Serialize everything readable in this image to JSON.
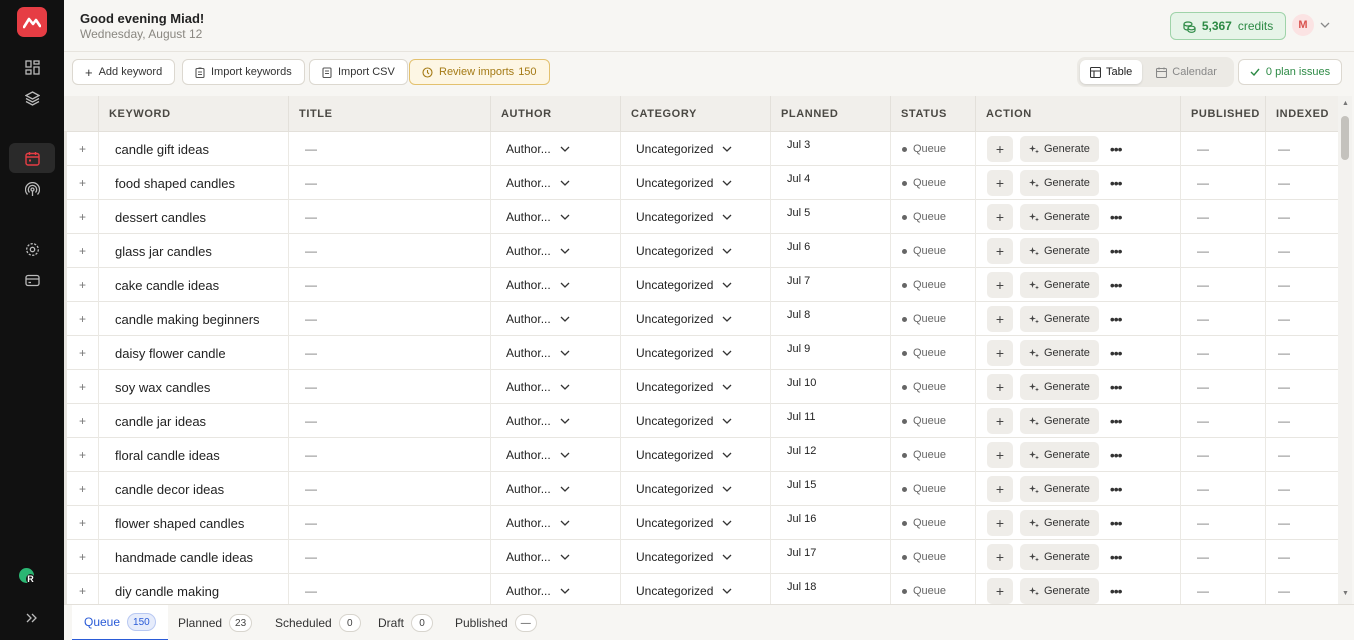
{
  "header": {
    "greeting": "Good evening Miad!",
    "date": "Wednesday, August 12",
    "credits": "5,367",
    "credits_label": "credits",
    "avatar_initial": "M"
  },
  "sidebar": {
    "status_initial": "R",
    "active_item": "calendar",
    "accent_color": "#e63d44"
  },
  "toolbar": {
    "add_keyword": "Add keyword",
    "import_keywords": "Import keywords",
    "import_csv": "Import CSV",
    "review_imports": "Review imports",
    "review_count": "150",
    "view_table": "Table",
    "view_calendar": "Calendar",
    "plan_issues": "0 plan issues"
  },
  "table": {
    "columns": [
      "KEYWORD",
      "TITLE",
      "AUTHOR",
      "CATEGORY",
      "PLANNED",
      "STATUS",
      "ACTION",
      "PUBLISHED",
      "INDEXED"
    ],
    "rows": [
      {
        "keyword": "candle gift ideas",
        "title": "—",
        "author": "Author...",
        "category": "Uncategorized",
        "planned": "Jul 3",
        "status": "Queue",
        "published": "—",
        "indexed": "—"
      },
      {
        "keyword": "food shaped candles",
        "title": "—",
        "author": "Author...",
        "category": "Uncategorized",
        "planned": "Jul 4",
        "status": "Queue",
        "published": "—",
        "indexed": "—"
      },
      {
        "keyword": "dessert candles",
        "title": "—",
        "author": "Author...",
        "category": "Uncategorized",
        "planned": "Jul 5",
        "status": "Queue",
        "published": "—",
        "indexed": "—"
      },
      {
        "keyword": "glass jar candles",
        "title": "—",
        "author": "Author...",
        "category": "Uncategorized",
        "planned": "Jul 6",
        "status": "Queue",
        "published": "—",
        "indexed": "—"
      },
      {
        "keyword": "cake candle ideas",
        "title": "—",
        "author": "Author...",
        "category": "Uncategorized",
        "planned": "Jul 7",
        "status": "Queue",
        "published": "—",
        "indexed": "—"
      },
      {
        "keyword": "candle making beginners",
        "title": "—",
        "author": "Author...",
        "category": "Uncategorized",
        "planned": "Jul 8",
        "status": "Queue",
        "published": "—",
        "indexed": "—"
      },
      {
        "keyword": "daisy flower candle",
        "title": "—",
        "author": "Author...",
        "category": "Uncategorized",
        "planned": "Jul 9",
        "status": "Queue",
        "published": "—",
        "indexed": "—"
      },
      {
        "keyword": "soy wax candles",
        "title": "—",
        "author": "Author...",
        "category": "Uncategorized",
        "planned": "Jul 10",
        "status": "Queue",
        "published": "—",
        "indexed": "—"
      },
      {
        "keyword": "candle jar ideas",
        "title": "—",
        "author": "Author...",
        "category": "Uncategorized",
        "planned": "Jul 11",
        "status": "Queue",
        "published": "—",
        "indexed": "—"
      },
      {
        "keyword": "floral candle ideas",
        "title": "—",
        "author": "Author...",
        "category": "Uncategorized",
        "planned": "Jul 12",
        "status": "Queue",
        "published": "—",
        "indexed": "—"
      },
      {
        "keyword": "candle decor ideas",
        "title": "—",
        "author": "Author...",
        "category": "Uncategorized",
        "planned": "Jul 15",
        "status": "Queue",
        "published": "—",
        "indexed": "—"
      },
      {
        "keyword": "flower shaped candles",
        "title": "—",
        "author": "Author...",
        "category": "Uncategorized",
        "planned": "Jul 16",
        "status": "Queue",
        "published": "—",
        "indexed": "—"
      },
      {
        "keyword": "handmade candle ideas",
        "title": "—",
        "author": "Author...",
        "category": "Uncategorized",
        "planned": "Jul 17",
        "status": "Queue",
        "published": "—",
        "indexed": "—"
      },
      {
        "keyword": "diy candle making",
        "title": "—",
        "author": "Author...",
        "category": "Uncategorized",
        "planned": "Jul 18",
        "status": "Queue",
        "published": "—",
        "indexed": "—"
      }
    ],
    "action_add": "+",
    "action_generate": "Generate",
    "action_more": "•••"
  },
  "tabs": [
    {
      "label": "Queue",
      "count": "150",
      "active": true
    },
    {
      "label": "Planned",
      "count": "23",
      "active": false
    },
    {
      "label": "Scheduled",
      "count": "0",
      "active": false
    },
    {
      "label": "Draft",
      "count": "0",
      "active": false
    },
    {
      "label": "Published",
      "count": "—",
      "active": false
    }
  ]
}
